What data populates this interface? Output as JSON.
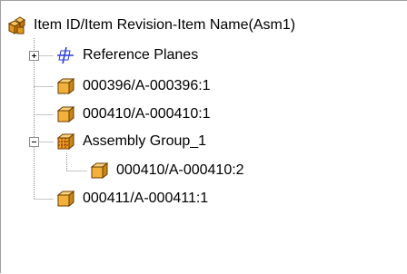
{
  "tree": {
    "root": {
      "label": "Item ID/Item Revision-Item Name(Asm1)",
      "icon": "assembly-icon"
    },
    "items": [
      {
        "label": "Reference Planes",
        "icon": "reference-planes-icon",
        "toggle": "collapsed"
      },
      {
        "label": "000396/A-000396:1",
        "icon": "part-icon"
      },
      {
        "label": "000410/A-000410:1",
        "icon": "part-icon"
      },
      {
        "label": "Assembly Group_1",
        "icon": "assembly-group-icon",
        "toggle": "expanded",
        "children": [
          {
            "label": "000410/A-000410:2",
            "icon": "part-icon"
          }
        ]
      },
      {
        "label": "000411/A-000411:1",
        "icon": "part-icon"
      }
    ]
  },
  "colors": {
    "part_fill": "#f2b13a",
    "part_edge": "#6a3a00",
    "plane_blue": "#2a3fd8",
    "group_fill": "#f0a020"
  }
}
